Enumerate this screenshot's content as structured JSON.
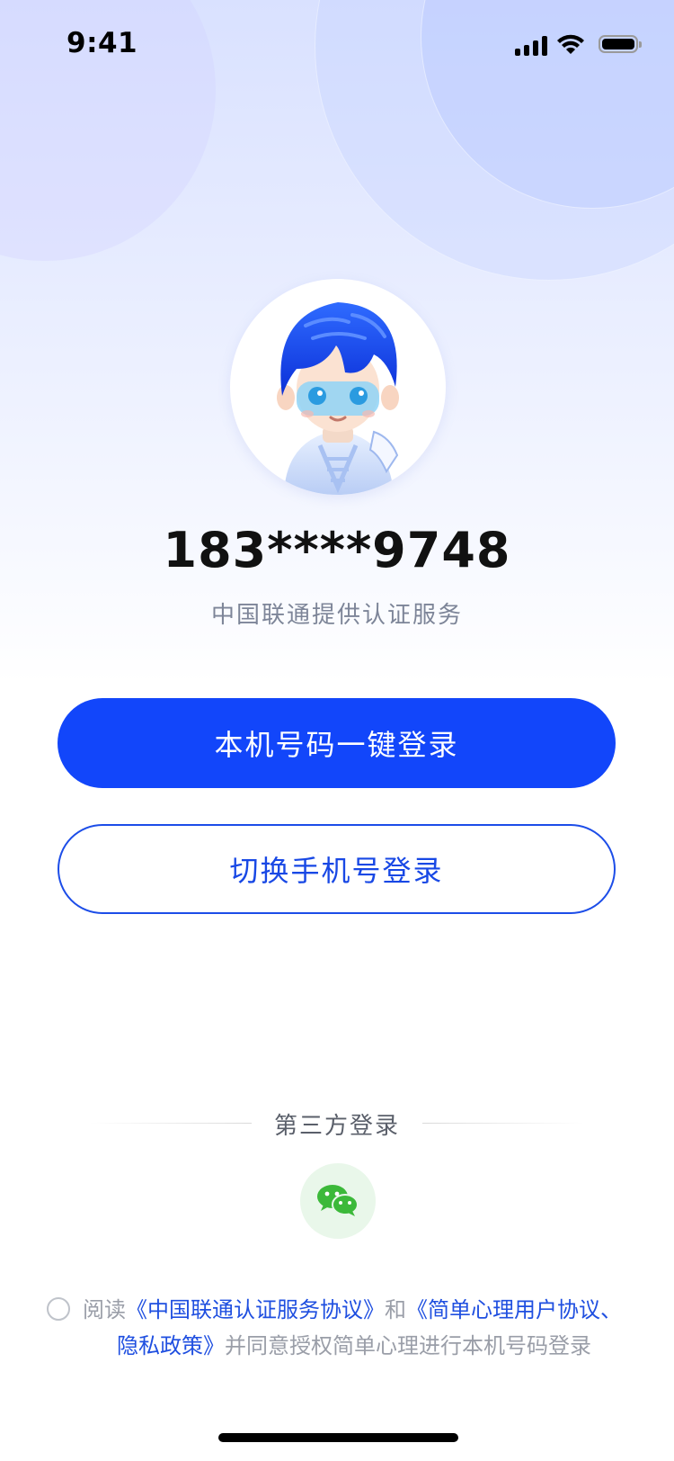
{
  "status_bar": {
    "time": "9:41",
    "battery_level": 0.9,
    "signal_bars": 4,
    "wifi": true
  },
  "profile": {
    "phone_masked": "183****9748",
    "provider_text": "中国联通提供认证服务"
  },
  "buttons": {
    "one_click_login": "本机号码一键登录",
    "switch_phone_login": "切换手机号登录"
  },
  "third_party": {
    "title": "第三方登录",
    "providers": [
      {
        "name": "wechat-icon",
        "color": "#3cb93a"
      }
    ]
  },
  "agreement": {
    "prefix": "阅读",
    "link1": "《中国联通认证服务协议》",
    "and": "和",
    "link2_line1": "《简单心理用户协议、",
    "link2_line2": "隐私政策》",
    "suffix": "并同意授权简单心理进行本机号码登录",
    "checked": false
  },
  "colors": {
    "primary": "#1246fa",
    "link": "#1f4fe0",
    "muted": "#7d8598"
  }
}
